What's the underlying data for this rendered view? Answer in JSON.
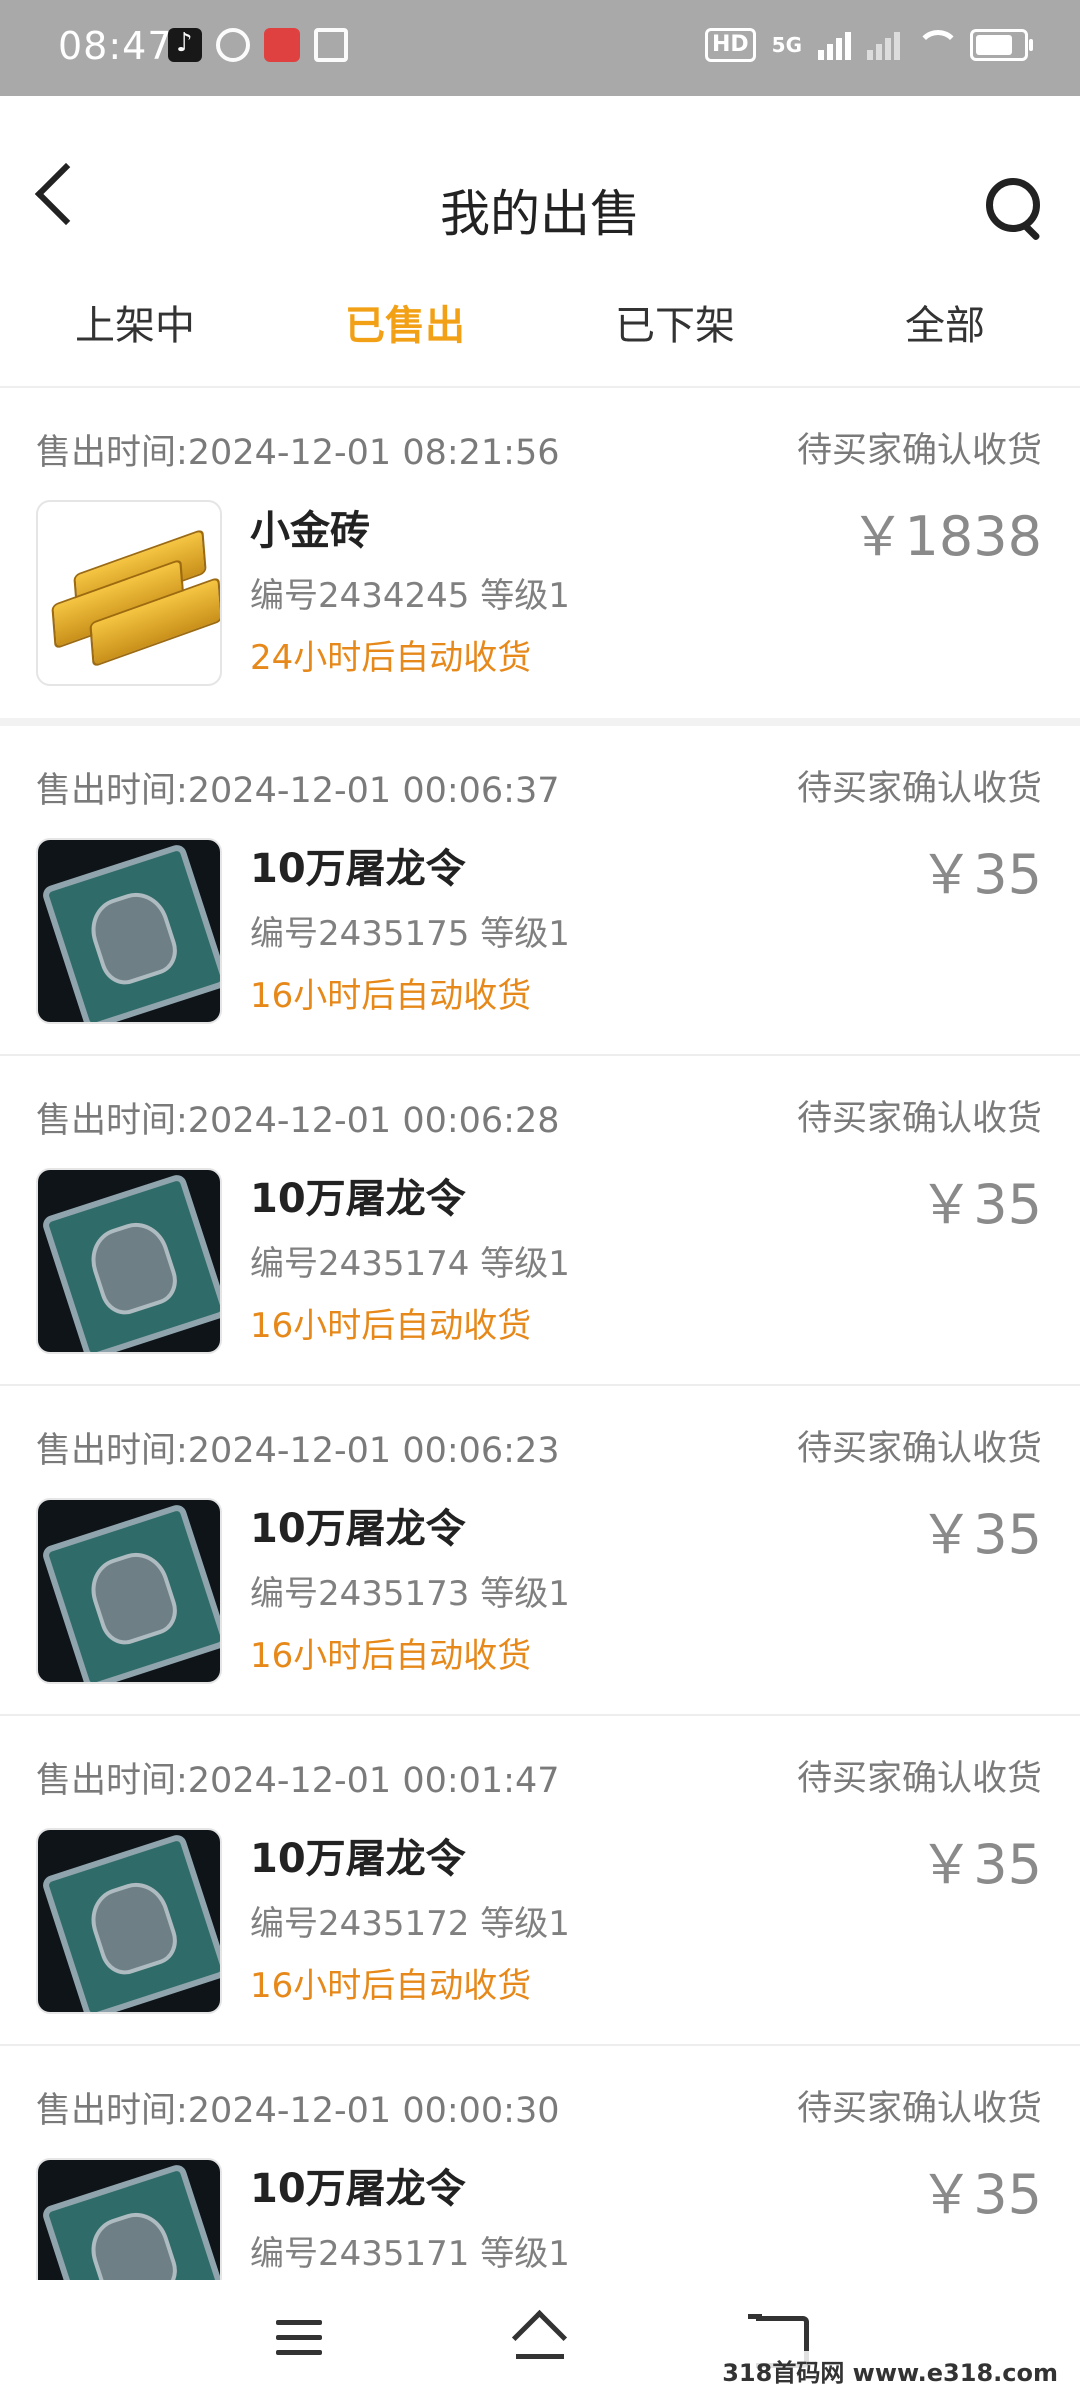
{
  "status_bar": {
    "time": "08:47",
    "network": "5G",
    "hd": "HD"
  },
  "header": {
    "title": "我的出售"
  },
  "tabs": [
    {
      "label": "上架中",
      "active": false
    },
    {
      "label": "已售出",
      "active": true
    },
    {
      "label": "已下架",
      "active": false
    },
    {
      "label": "全部",
      "active": false
    }
  ],
  "orders": [
    {
      "time": "售出时间:2024-12-01 08:21:56",
      "status": "待买家确认收货",
      "name": "小金砖",
      "meta": "编号2434245 等级1",
      "auto": "24小时后自动收货",
      "price": "￥1838",
      "icon": "gold-bar"
    },
    {
      "time": "售出时间:2024-12-01 00:06:37",
      "status": "待买家确认收货",
      "name": "10万屠龙令",
      "meta": "编号2435175 等级1",
      "auto": "16小时后自动收货",
      "price": "￥35",
      "icon": "dragon-token"
    },
    {
      "time": "售出时间:2024-12-01 00:06:28",
      "status": "待买家确认收货",
      "name": "10万屠龙令",
      "meta": "编号2435174 等级1",
      "auto": "16小时后自动收货",
      "price": "￥35",
      "icon": "dragon-token"
    },
    {
      "time": "售出时间:2024-12-01 00:06:23",
      "status": "待买家确认收货",
      "name": "10万屠龙令",
      "meta": "编号2435173 等级1",
      "auto": "16小时后自动收货",
      "price": "￥35",
      "icon": "dragon-token"
    },
    {
      "time": "售出时间:2024-12-01 00:01:47",
      "status": "待买家确认收货",
      "name": "10万屠龙令",
      "meta": "编号2435172 等级1",
      "auto": "16小时后自动收货",
      "price": "￥35",
      "icon": "dragon-token"
    },
    {
      "time": "售出时间:2024-12-01 00:00:30",
      "status": "待买家确认收货",
      "name": "10万屠龙令",
      "meta": "编号2435171 等级1",
      "auto": "",
      "price": "￥35",
      "icon": "dragon-token"
    }
  ],
  "watermark": "318首码网 www.e318.com",
  "colors": {
    "active_tab": "#f2a117",
    "auto_receive": "#e6891a",
    "status_bar": "#a9a9a9"
  }
}
